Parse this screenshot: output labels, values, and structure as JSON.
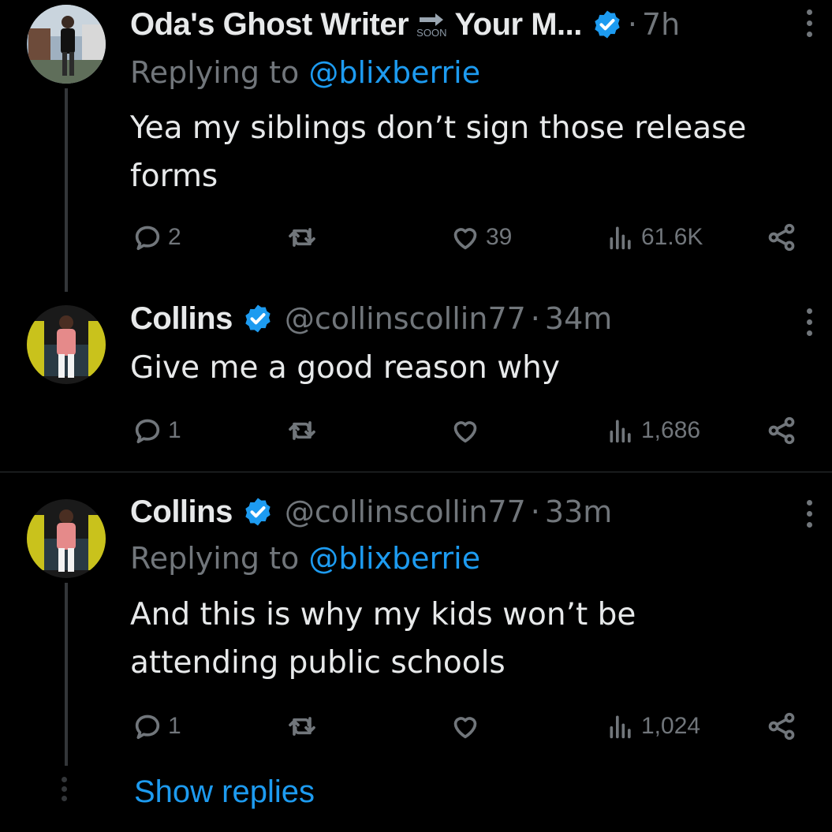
{
  "tweets": [
    {
      "name": "Oda's Ghost Writer",
      "name_suffix": "Your M...",
      "arrow_label": "SOON",
      "time": "7h",
      "replying_prefix": "Replying to",
      "replying_to": "@blixberrie",
      "text_lines": [
        "Yea my siblings don’t sign those release",
        "forms"
      ],
      "replies": "2",
      "likes": "39",
      "views": "61.6K"
    },
    {
      "name": "Collins",
      "handle": "@collinscollin77",
      "time": "34m",
      "text_lines": [
        "Give me a good reason why"
      ],
      "replies": "1",
      "views": "1,686"
    },
    {
      "name": "Collins",
      "handle": "@collinscollin77",
      "time": "33m",
      "replying_prefix": "Replying to",
      "replying_to": "@blixberrie",
      "text_lines": [
        "And this is why my kids won’t be",
        "attending public schools"
      ],
      "replies": "1",
      "views": "1,024"
    }
  ],
  "show_replies": "Show replies",
  "colors": {
    "accent": "#1d9bf0",
    "muted": "#71767b",
    "text": "#e7e9ea",
    "background": "#000000"
  },
  "icons": [
    "reply-icon",
    "retweet-icon",
    "like-icon",
    "views-icon",
    "share-icon",
    "verified-badge-icon",
    "more-icon"
  ]
}
